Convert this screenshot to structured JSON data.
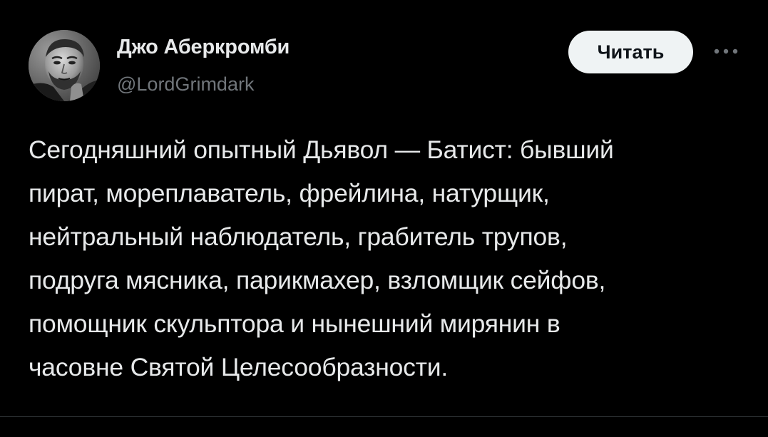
{
  "author": {
    "display_name": "Джо Аберкромби",
    "handle": "@LordGrimdark"
  },
  "actions": {
    "follow_label": "Читать",
    "more_icon": "more-horizontal-icon"
  },
  "tweet": {
    "lines": [
      "Сегодняшний опытный Дьявол — Батист: бывший",
      "пират, мореплаватель, фрейлина, натурщик,",
      "нейтральный наблюдатель, грабитель трупов,",
      "подруга мясника, парикмахер, взломщик сейфов,",
      "помощник скульптора и нынешний мирянин в",
      "часовне Святой Целесообразности."
    ]
  },
  "colors": {
    "background": "#000000",
    "text_primary": "#e7e9ea",
    "text_secondary": "#71767b",
    "button_bg": "#eff3f4",
    "button_text": "#0f1419",
    "divider": "#2f3336"
  }
}
